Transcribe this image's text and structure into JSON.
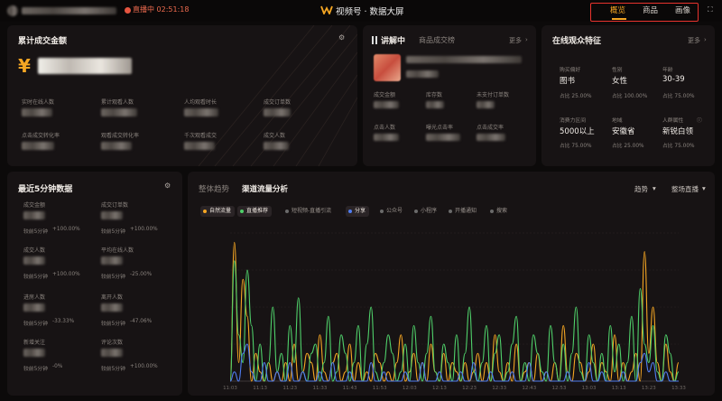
{
  "header": {
    "live_status": "直播中 02:51:18",
    "app_title": "视频号 · 数据大屏",
    "nav": [
      "概览",
      "商品",
      "画像"
    ],
    "active_nav": "概览"
  },
  "summary": {
    "title": "累计成交金额",
    "currency": "¥",
    "metrics": [
      "实时在线人数",
      "累计观看人数",
      "人均观看时长",
      "成交订单数",
      "点击成交转化率",
      "观看成交转化率",
      "千次观看成交",
      "成交人数"
    ]
  },
  "product": {
    "tab_explaining": "讲解中",
    "tab_ranking": "商品成交榜",
    "more": "更多",
    "metrics": [
      "成交金额",
      "库存数",
      "未支付订单数",
      "点击人数",
      "曝光点击率",
      "点击成交率"
    ]
  },
  "audience": {
    "title": "在线观众特征",
    "more": "更多",
    "traits": [
      {
        "label": "购买偏好",
        "value": "图书",
        "share": "占比 25.00%"
      },
      {
        "label": "性别",
        "value": "女性",
        "share": "占比 100.00%"
      },
      {
        "label": "年龄",
        "value": "30-39",
        "share": "占比 75.00%"
      },
      {
        "label": "消费力区间",
        "value": "5000以上",
        "share": "占比 75.00%"
      },
      {
        "label": "地域",
        "value": "安徽省",
        "share": "占比 25.00%"
      },
      {
        "label": "人群属性",
        "value": "新锐白领",
        "share": "占比 75.00%"
      }
    ]
  },
  "recent": {
    "title": "最近5分钟数据",
    "items": [
      {
        "label": "成交金额",
        "compare": "较前5分钟",
        "delta": "+100.00%",
        "trend": "up"
      },
      {
        "label": "成交订单数",
        "compare": "较前5分钟",
        "delta": "+100.00%",
        "trend": "up"
      },
      {
        "label": "成交人数",
        "compare": "较前5分钟",
        "delta": "+100.00%",
        "trend": "up"
      },
      {
        "label": "平均在线人数",
        "compare": "较前5分钟",
        "delta": "-25.00%",
        "trend": "down"
      },
      {
        "label": "进房人数",
        "compare": "较前5分钟",
        "delta": "-33.33%",
        "trend": "down"
      },
      {
        "label": "离开人数",
        "compare": "较前5分钟",
        "delta": "-47.06%",
        "trend": "down"
      },
      {
        "label": "新增关注",
        "compare": "较前5分钟",
        "delta": "-0%",
        "trend": "down"
      },
      {
        "label": "评论次数",
        "compare": "较前5分钟",
        "delta": "+100.00%",
        "trend": "up"
      }
    ]
  },
  "traffic": {
    "tab_overall": "整体趋势",
    "tab_channel": "渠道流量分析",
    "dropdown_trend": "趋势",
    "dropdown_scope": "整场直播",
    "chips": [
      {
        "label": "自然流量",
        "color": "#f5a623",
        "on": true
      },
      {
        "label": "直播推荐",
        "color": "#4fd06a",
        "on": true
      },
      {
        "label": "短视频-直播引流",
        "color": "#6a6a6a",
        "on": false
      },
      {
        "label": "分享",
        "color": "#4f7cf0",
        "on": true
      },
      {
        "label": "公众号",
        "color": "#6a6a6a",
        "on": false
      },
      {
        "label": "小程序",
        "color": "#6a6a6a",
        "on": false
      },
      {
        "label": "开播通知",
        "color": "#6a6a6a",
        "on": false
      },
      {
        "label": "搜索",
        "color": "#6a6a6a",
        "on": false
      }
    ]
  },
  "chart_data": {
    "type": "line",
    "title": "",
    "xlabel": "",
    "ylabel": "",
    "series": [
      {
        "name": "自然流量",
        "color": "#f5a623",
        "values": [
          0,
          15,
          2,
          11,
          7,
          0,
          3,
          1,
          0,
          2,
          0,
          1,
          0,
          2,
          0,
          4,
          0,
          1,
          3,
          2,
          0,
          5,
          1,
          0,
          2,
          3,
          0,
          1,
          4,
          0,
          2,
          0,
          1,
          0,
          3,
          2,
          0,
          1,
          0,
          2,
          5,
          0,
          1,
          3,
          0,
          2,
          0,
          4,
          1,
          0,
          3,
          0,
          2,
          1,
          0,
          2,
          0,
          1,
          3,
          0,
          2,
          0,
          5,
          1,
          0,
          2,
          0,
          4,
          0,
          1,
          2,
          0,
          3,
          0,
          1,
          0,
          2,
          0,
          6,
          1,
          0,
          3,
          2,
          0,
          1,
          4,
          0,
          2,
          1,
          0,
          5,
          0,
          2,
          0,
          1,
          3,
          0,
          14,
          3,
          8,
          2,
          0,
          4,
          1,
          0,
          2
        ]
      },
      {
        "name": "直播推荐",
        "color": "#4fd06a",
        "values": [
          0,
          13,
          5,
          2,
          12,
          6,
          0,
          4,
          0,
          2,
          8,
          1,
          3,
          0,
          6,
          2,
          9,
          1,
          0,
          3,
          4,
          0,
          2,
          7,
          0,
          1,
          5,
          3,
          0,
          2,
          6,
          0,
          4,
          8,
          1,
          0,
          2,
          5,
          3,
          0,
          1,
          4,
          0,
          6,
          2,
          0,
          3,
          7,
          1,
          0,
          4,
          2,
          0,
          5,
          0,
          3,
          8,
          1,
          0,
          2,
          6,
          0,
          3,
          5,
          0,
          1,
          4,
          7,
          0,
          2,
          0,
          5,
          3,
          1,
          0,
          6,
          2,
          0,
          4,
          0,
          3,
          8,
          1,
          0,
          5,
          2,
          0,
          3,
          0,
          6,
          1,
          4,
          0,
          2,
          7,
          0,
          10,
          4,
          2,
          6,
          1,
          0,
          5,
          3,
          0,
          1
        ]
      },
      {
        "name": "分享",
        "color": "#4f7cf0",
        "values": [
          0,
          1,
          0,
          3,
          4,
          1,
          0,
          0,
          2,
          0,
          0,
          1,
          0,
          0,
          2,
          0,
          0,
          1,
          0,
          0,
          0,
          1,
          0,
          0,
          2,
          0,
          0,
          0,
          1,
          0,
          0,
          0,
          0,
          2,
          0,
          0,
          1,
          0,
          0,
          0,
          0,
          1,
          0,
          0,
          0,
          2,
          0,
          0,
          0,
          1,
          0,
          0,
          0,
          0,
          1,
          0,
          0,
          2,
          0,
          0,
          0,
          1,
          0,
          0,
          0,
          0,
          1,
          0,
          0,
          0,
          2,
          0,
          0,
          0,
          1,
          0,
          0,
          0,
          0,
          1,
          0,
          0,
          0,
          0,
          2,
          0,
          0,
          1,
          0,
          0,
          0,
          0,
          1,
          0,
          0,
          0,
          2,
          3,
          1,
          2,
          0,
          0,
          1,
          0,
          0,
          0
        ]
      }
    ],
    "x_ticks": [
      "11:03",
      "11:13",
      "11:23",
      "11:33",
      "11:43",
      "11:53",
      "12:03",
      "12:13",
      "12:23",
      "12:33",
      "12:43",
      "12:53",
      "13:03",
      "13:13",
      "13:23",
      "13:33"
    ],
    "ylim": [
      0,
      16
    ],
    "grid": true
  }
}
